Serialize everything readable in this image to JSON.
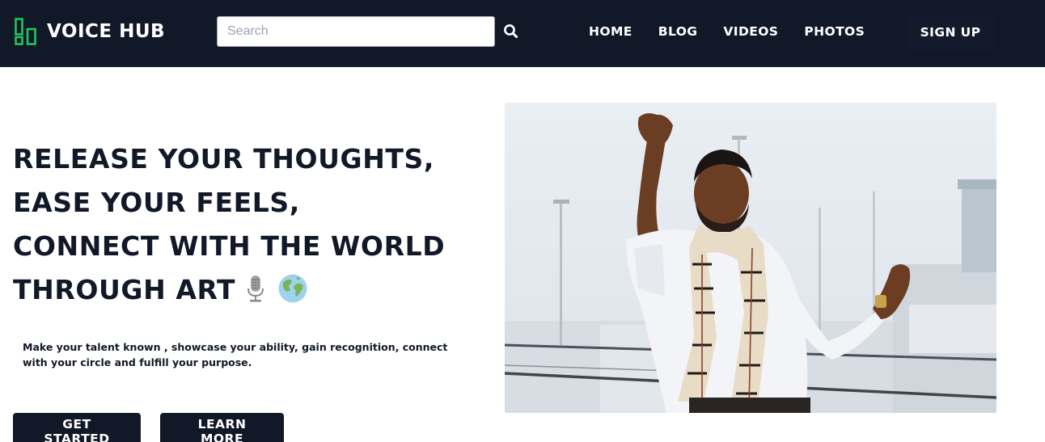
{
  "brand": {
    "name": "VOICE HUB",
    "logo_icon": "bar-chart-logo-icon",
    "accent_color": "#22c55e"
  },
  "search": {
    "placeholder": "Search",
    "value": "",
    "icon": "search-icon"
  },
  "nav": {
    "links": [
      "HOME",
      "BLOG",
      "VIDEOS",
      "PHOTOS"
    ],
    "signup_label": "SIGN UP",
    "background": "#111827"
  },
  "hero": {
    "headline_lines": [
      "RELEASE YOUR THOUGHTS,",
      "EASE YOUR FEELS,",
      "CONNECT WITH THE WORLD",
      "THROUGH ART"
    ],
    "headline_icons": [
      "microphone-icon",
      "globe-icon"
    ],
    "subtext": "Make your talent known , showcase your ability, gain recognition, connect with your circle and fulfill your purpose.",
    "primary_button": "GET STARTED",
    "secondary_button": "LEARN MORE",
    "image_subject": "man-dancing-with-scarf-photo"
  }
}
